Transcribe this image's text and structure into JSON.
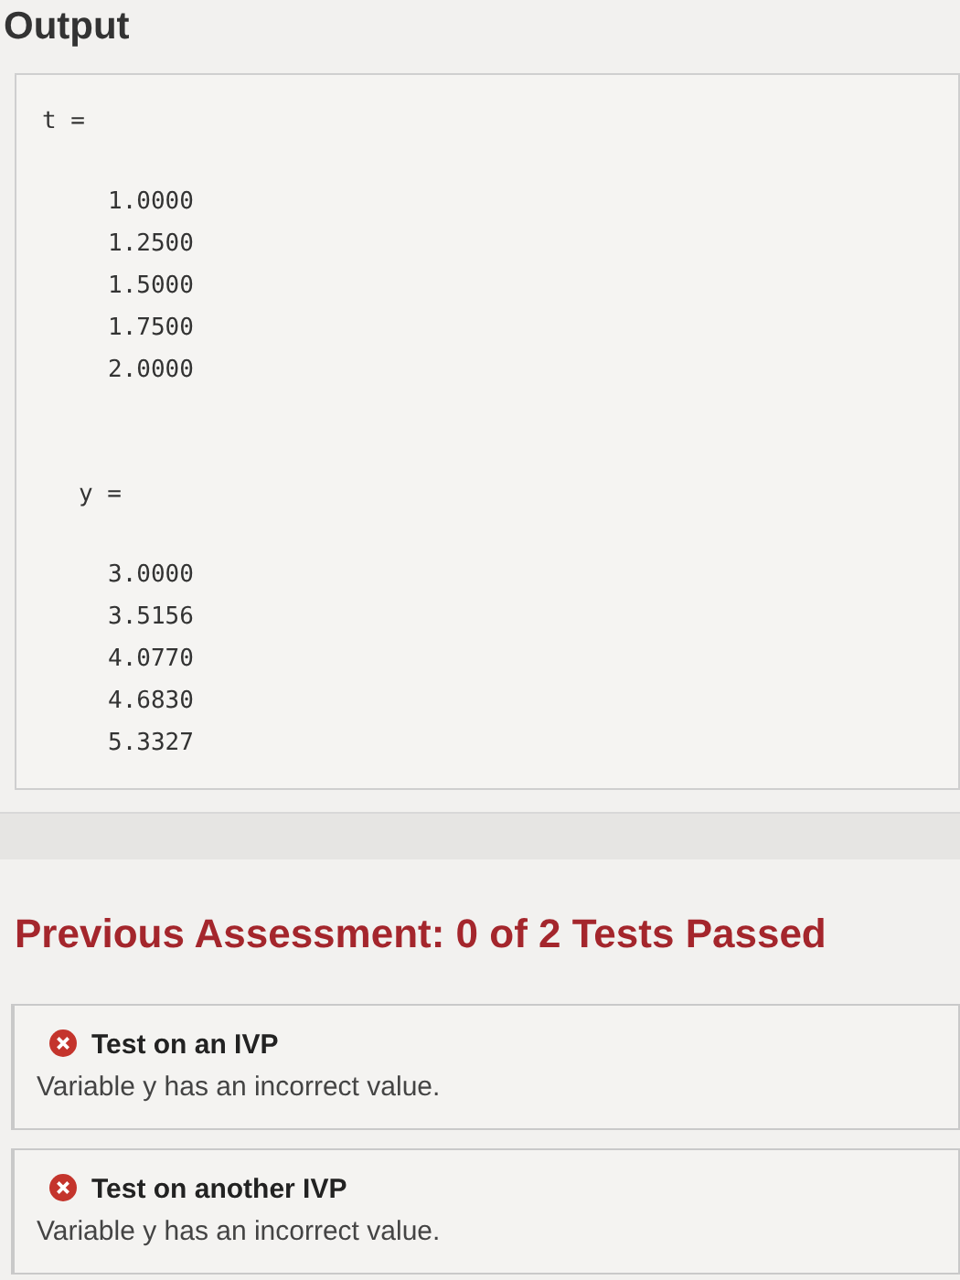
{
  "output": {
    "title": "Output",
    "blocks": [
      {
        "label": "t =",
        "values": [
          "1.0000",
          "1.2500",
          "1.5000",
          "1.7500",
          "2.0000"
        ]
      },
      {
        "label": "y =",
        "values": [
          "3.0000",
          "3.5156",
          "4.0770",
          "4.6830",
          "5.3327"
        ]
      }
    ]
  },
  "assessment": {
    "title": "Previous Assessment: 0 of 2 Tests Passed",
    "tests": [
      {
        "name": "Test on an IVP",
        "message": "Variable y has an incorrect value.",
        "passed": false
      },
      {
        "name": "Test on another IVP",
        "message": "Variable y has an incorrect value.",
        "passed": false
      }
    ]
  }
}
